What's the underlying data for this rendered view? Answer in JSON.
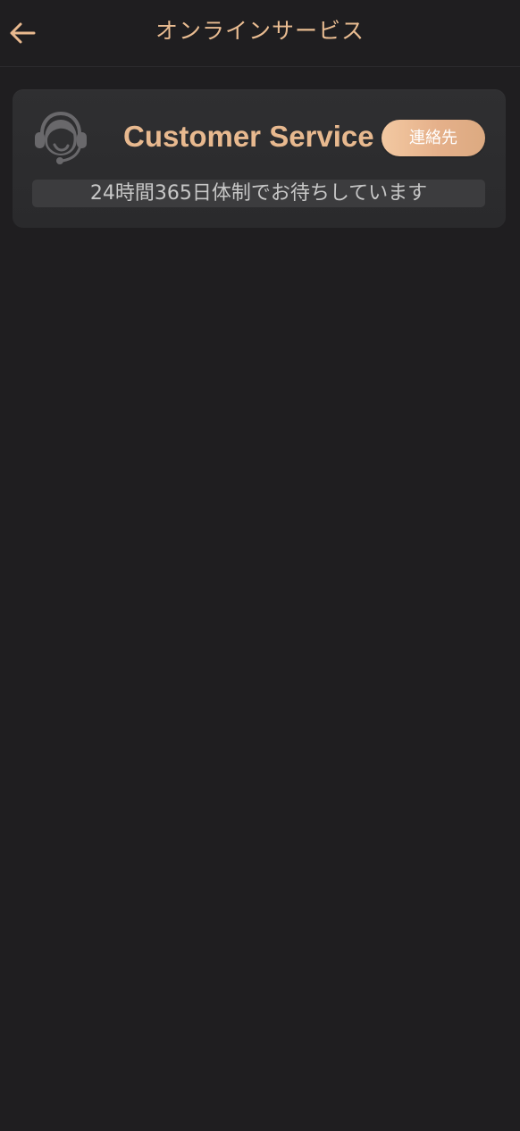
{
  "header": {
    "title": "オンラインサービス",
    "back_icon": "arrow-left-icon"
  },
  "service_card": {
    "avatar_icon": "customer-service-headset-icon",
    "name": "Customer Service",
    "contact_label": "連絡先",
    "availability_text": "24時間365日体制でお待ちしています"
  },
  "colors": {
    "background": "#1f1e20",
    "accent": "#e8b98f",
    "card_background": "#2d2d2f",
    "button_gradient_start": "#f3c9a2",
    "button_gradient_end": "#dcaa81",
    "availability_background": "#3c3c3e",
    "availability_text": "#c7c7c7",
    "icon_gray": "#69686b"
  }
}
